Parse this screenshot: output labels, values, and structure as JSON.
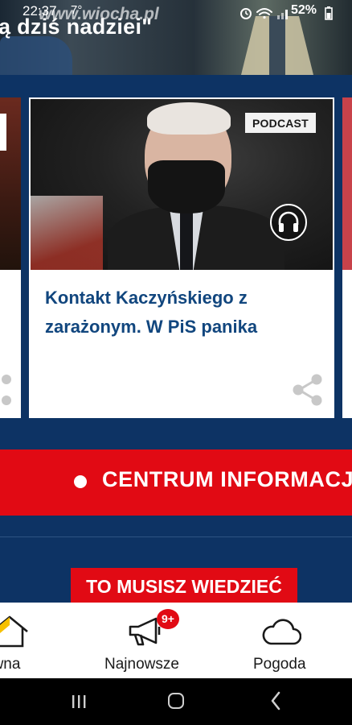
{
  "status_bar": {
    "time": "22:37",
    "temperature": "7°",
    "battery": "52%",
    "watermark": "www.wiocha.pl"
  },
  "hero": {
    "title_fragment": "ą dziś nadziei\""
  },
  "card": {
    "badge": "PODCAST",
    "title": "Kontakt Kaczyńskiego z zarażonym. W PiS panika",
    "icon": "headphones-icon",
    "share_icon": "share-icon"
  },
  "banner": {
    "text": "CENTRUM INFORMACJ"
  },
  "section": {
    "label": "TO MUSISZ WIEDZIEĆ"
  },
  "bottom_nav": {
    "items": [
      {
        "label": "ówna",
        "icon": "home-icon"
      },
      {
        "label": "Najnowsze",
        "icon": "megaphone-icon",
        "badge": "9+"
      },
      {
        "label": "Pogoda",
        "icon": "cloud-icon"
      }
    ]
  },
  "colors": {
    "navy": "#0d3364",
    "accent_red": "#e10a14",
    "title_blue": "#11467e"
  }
}
